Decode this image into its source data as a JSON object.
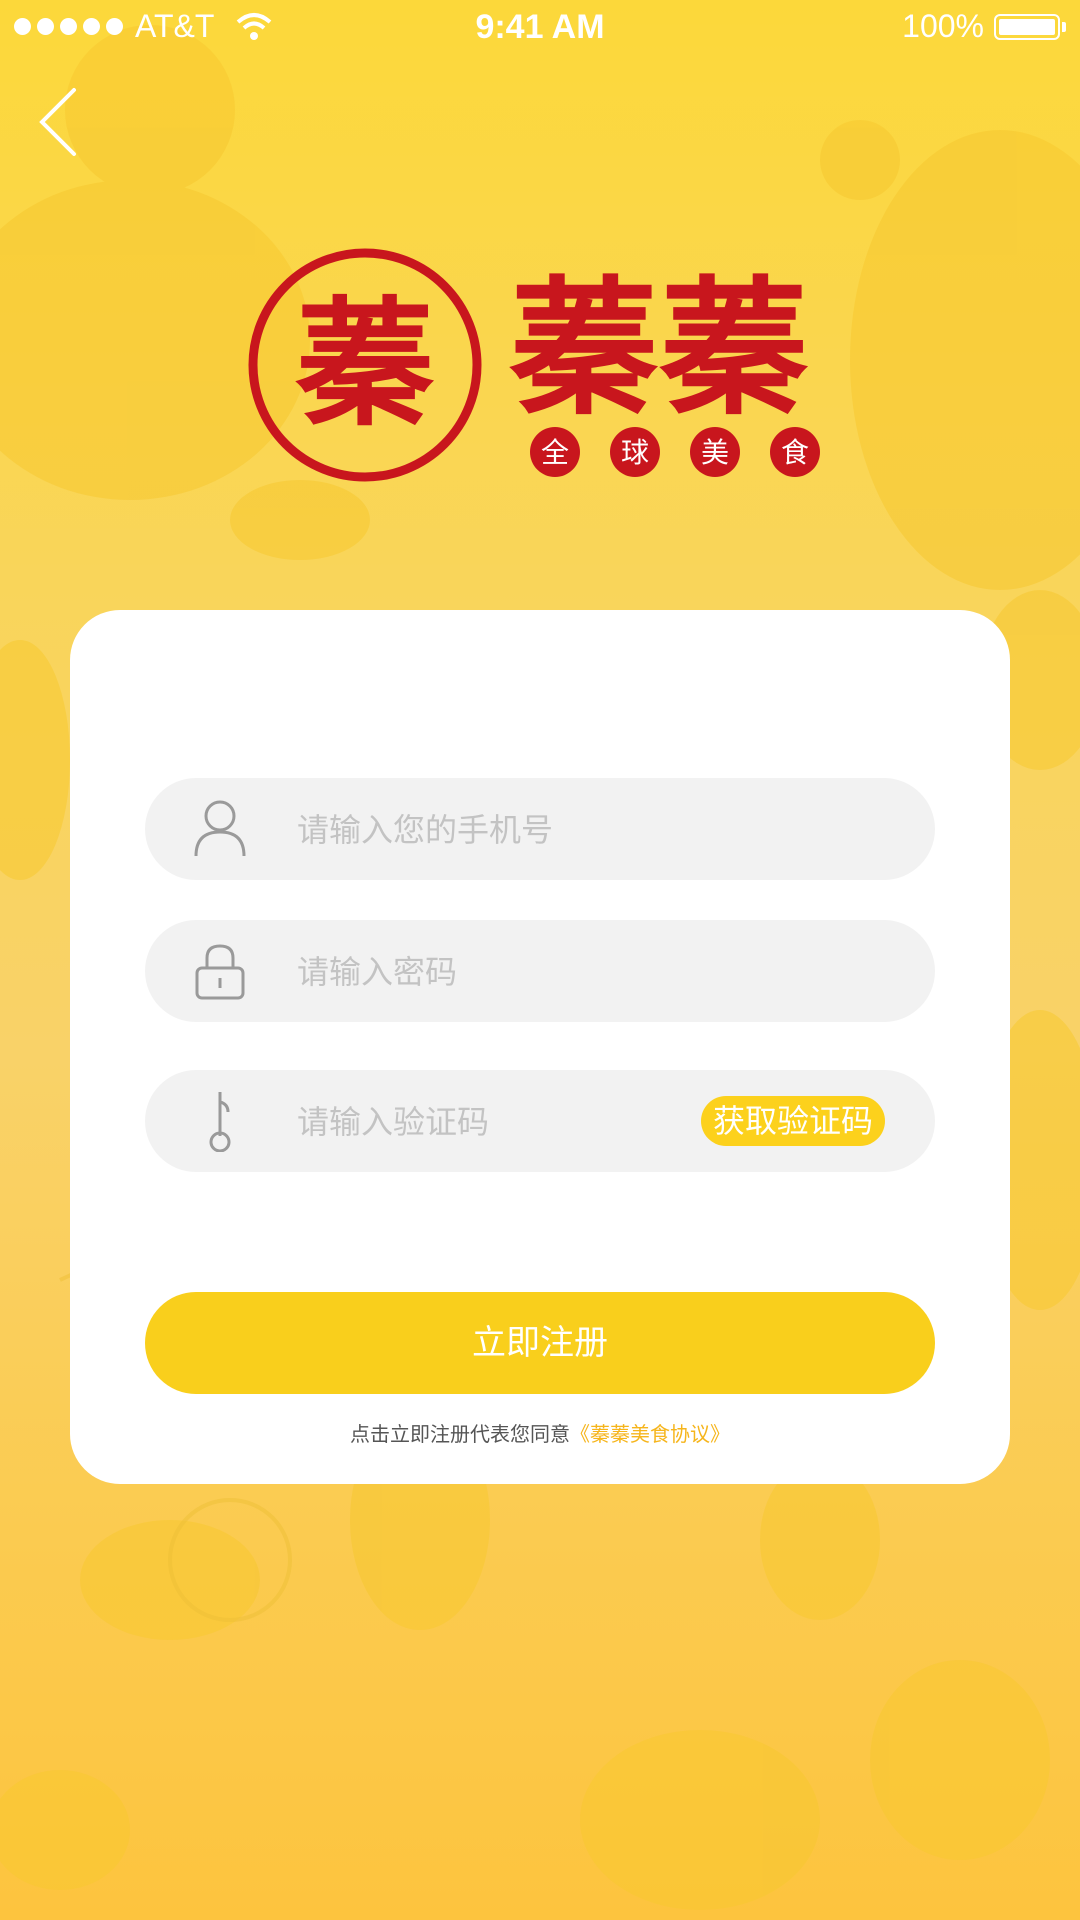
{
  "status_bar": {
    "carrier": "AT&T",
    "time": "9:41 AM",
    "battery": "100%"
  },
  "logo": {
    "seal_char": "蓁",
    "brand_name": "蓁蓁",
    "tags": [
      "全",
      "球",
      "美",
      "食"
    ]
  },
  "form": {
    "phone_placeholder": "请输入您的手机号",
    "password_placeholder": "请输入密码",
    "code_placeholder": "请输入验证码",
    "get_code_label": "获取验证码",
    "submit_label": "立即注册",
    "agreement_prefix": "点击立即注册代表您同意",
    "agreement_link": "《蓁蓁美食协议》"
  },
  "colors": {
    "accent": "#f9cf1c",
    "brand_red": "#c8161d",
    "link": "#f6b51c",
    "field_bg": "#f2f2f2"
  }
}
